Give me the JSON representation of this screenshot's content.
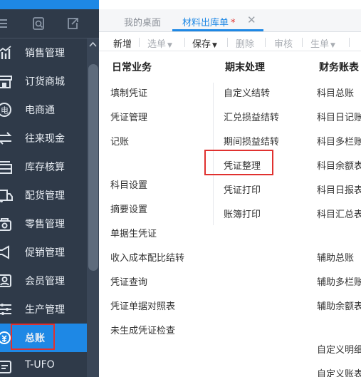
{
  "sidebar": {
    "toolbar_icons": [
      "menu-icon",
      "search-doc-icon",
      "export-doc-icon"
    ],
    "items": [
      {
        "label": "销售管理",
        "icon": "sales-chart-icon"
      },
      {
        "label": "订货商城",
        "icon": "store-icon"
      },
      {
        "label": "电商通",
        "icon": "ecommerce-icon"
      },
      {
        "label": "往来现金",
        "icon": "exchange-icon"
      },
      {
        "label": "库存核算",
        "icon": "inventory-icon"
      },
      {
        "label": "配货管理",
        "icon": "delivery-icon"
      },
      {
        "label": "零售管理",
        "icon": "retail-icon"
      },
      {
        "label": "促销管理",
        "icon": "megaphone-icon"
      },
      {
        "label": "会员管理",
        "icon": "member-icon"
      },
      {
        "label": "生产管理",
        "icon": "production-icon"
      },
      {
        "label": "总账",
        "icon": "ledger-icon",
        "active": true
      },
      {
        "label": "T-UFO",
        "icon": "report-icon"
      }
    ]
  },
  "tabs": [
    {
      "label": "我的桌面",
      "active": false
    },
    {
      "label": "材料出库单",
      "active": true,
      "modified_mark": "*"
    }
  ],
  "toolbar": {
    "new_label": "新增",
    "select_label": "选单",
    "save_label": "保存",
    "delete_label": "删除",
    "audit_label": "审核",
    "generate_label": "生单"
  },
  "columns": {
    "daily": {
      "title": "日常业务",
      "links": [
        "填制凭证",
        "凭证管理",
        "记账",
        "科目设置",
        "摘要设置",
        "单据生凭证",
        "收入成本配比结转",
        "凭证查询",
        "凭证单据对照表",
        "未生成凭证检查"
      ]
    },
    "period_end": {
      "title": "期末处理",
      "links": [
        "自定义结转",
        "汇兑损益结转",
        "期间损益结转",
        "凭证整理",
        "凭证打印",
        "账簿打印"
      ]
    },
    "finance": {
      "title": "财务账表",
      "links": [
        "科目总账",
        "科目日记账",
        "科目多栏账",
        "科目余额表",
        "科目日报表",
        "科目汇总表",
        "辅助总账",
        "辅助多栏账",
        "辅助余额表",
        "自定义明细",
        "自定义账表"
      ]
    }
  },
  "colors": {
    "sidebar_bg": "#2f3a49",
    "accent": "#1e88e5",
    "highlight": "#e0312f"
  }
}
